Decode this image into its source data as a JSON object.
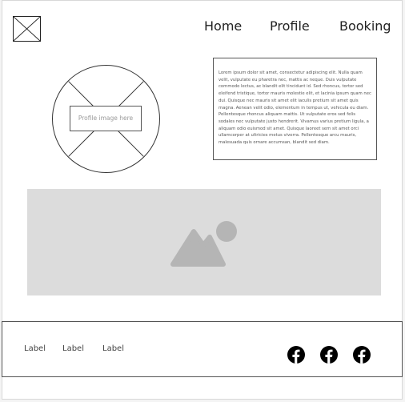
{
  "nav": {
    "items": [
      {
        "label": "Home"
      },
      {
        "label": "Profile"
      },
      {
        "label": "Booking"
      }
    ]
  },
  "profile": {
    "image_placeholder": "Profile image here"
  },
  "bio": {
    "text": "Lorem ipsum dolor sit amet, consectetur adipiscing elit. Nulla quam velit, vulputate eu pharetra nec, mattis ac neque. Duis vulputate commodo lectus, ac blandit elit tincidunt id. Sed rhoncus, tortor sed eleifend tristique, tortor mauris molestie elit, et lacinia ipsum quam nec dui. Quisque nec mauris sit amet elit iaculis pretium sit amet quis magna. Aenean velit odio, elementum in tempus ut, vehicula eu diam. Pellentesque rhoncus aliquam mattis. Ut vulputate eros sed felis sodales nec vulputate justo hendrerit. Vivamus varius pretium ligula, a aliquam odio euismod sit amet. Quisque laoreet sem sit amet orci ullamcorper at ultricies metus viverra. Pellentesque arcu mauris, malesuada quis ornare accumsan, blandit sed diam."
  },
  "footer": {
    "labels": [
      "Label",
      "Label",
      "Label"
    ],
    "social_icons": [
      "facebook-icon",
      "facebook-icon",
      "facebook-icon"
    ]
  },
  "colors": {
    "wireframe_line": "#333333",
    "image_placeholder_bg": "#dcdcdc",
    "image_icon": "#b5b5b5"
  }
}
